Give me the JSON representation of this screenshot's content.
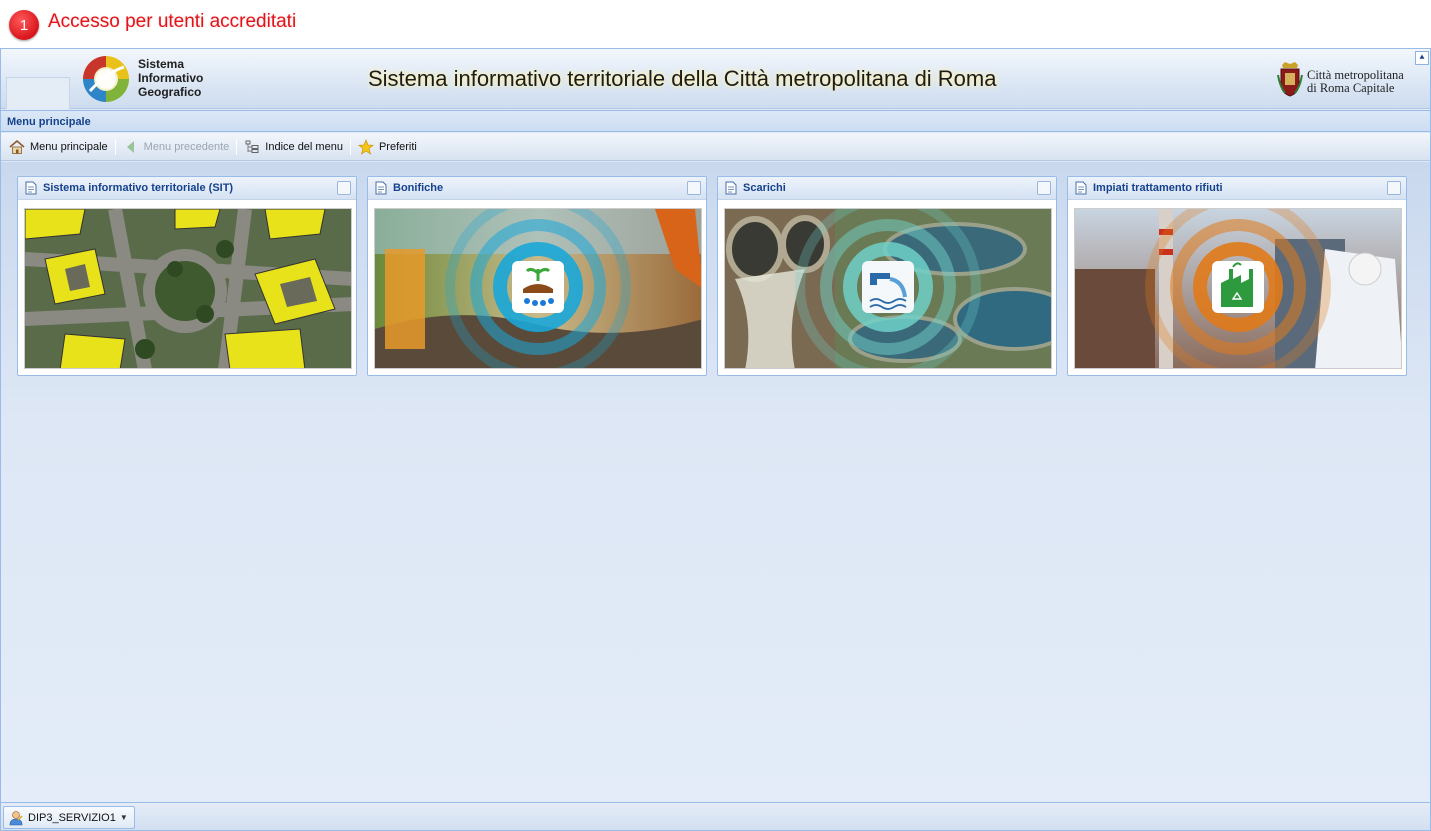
{
  "annotation": {
    "number": "1",
    "text": "Accesso per utenti accreditati"
  },
  "header": {
    "logo_lines": [
      "Sistema",
      "Informativo",
      "Geografico"
    ],
    "title": "Sistema informativo territoriale della Città metropolitana di Roma",
    "org_lines": [
      "Città metropolitana",
      "di Roma Capitale"
    ],
    "collapse_icon": "double-chevron-up-icon"
  },
  "panel": {
    "title": "Menu principale"
  },
  "toolbar": {
    "home_label": "Menu principale",
    "back_label": "Menu precedente",
    "index_label": "Indice del menu",
    "favorites_label": "Preferiti"
  },
  "cards": [
    {
      "title": "Sistema informativo territoriale (SIT)"
    },
    {
      "title": "Bonifiche",
      "accent": "#1aa7d8"
    },
    {
      "title": "Scarichi",
      "accent": "#6fd0c8"
    },
    {
      "title": "Impiati trattamento rifiuti",
      "accent": "#e07a1a"
    }
  ],
  "status": {
    "user": "DIP3_SERVIZIO1"
  }
}
